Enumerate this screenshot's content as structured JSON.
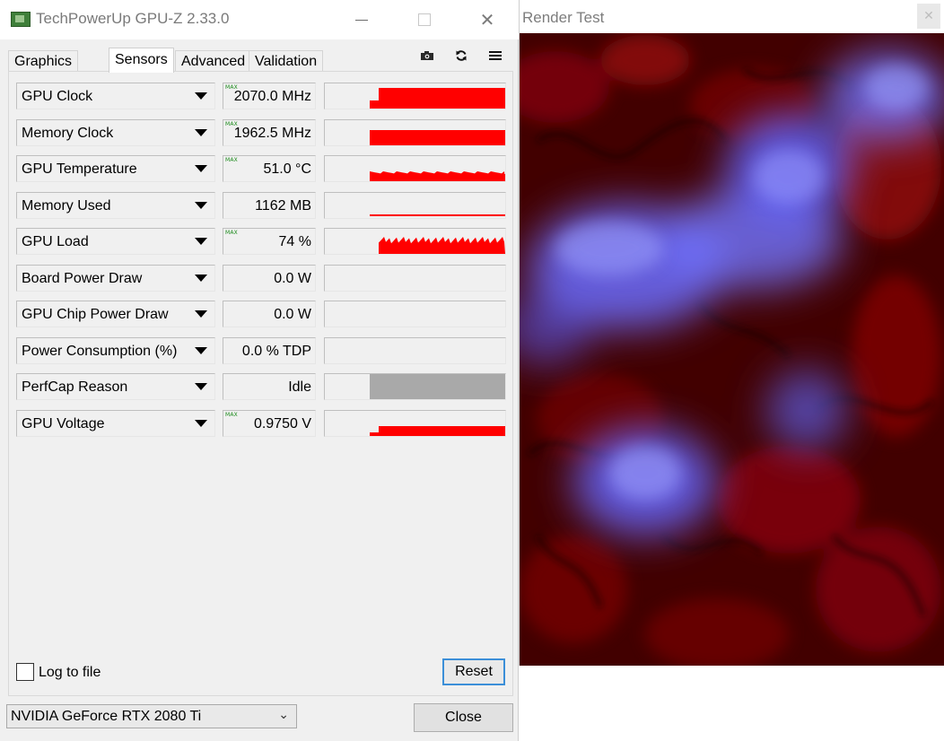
{
  "gpuz": {
    "title": "TechPowerUp GPU-Z 2.33.0",
    "tabs": [
      {
        "label": "Graphics Card",
        "active": false
      },
      {
        "label": "Sensors",
        "active": true
      },
      {
        "label": "Advanced",
        "active": false
      },
      {
        "label": "Validation",
        "active": false
      }
    ],
    "toolbar_icons": [
      "camera-icon",
      "refresh-icon",
      "menu-icon"
    ],
    "max_tag": "MAX",
    "sensors": [
      {
        "label": "GPU Clock",
        "value": "2070.0 MHz",
        "max": true,
        "graph": "step-high"
      },
      {
        "label": "Memory Clock",
        "value": "1962.5 MHz",
        "max": true,
        "graph": "block-high"
      },
      {
        "label": "GPU Temperature",
        "value": "51.0 °C",
        "max": true,
        "graph": "temp"
      },
      {
        "label": "Memory Used",
        "value": "1162 MB",
        "max": false,
        "graph": "line-low"
      },
      {
        "label": "GPU Load",
        "value": "74 %",
        "max": true,
        "graph": "noisy"
      },
      {
        "label": "Board Power Draw",
        "value": "0.0 W",
        "max": false,
        "graph": "none"
      },
      {
        "label": "GPU Chip Power Draw",
        "value": "0.0 W",
        "max": false,
        "graph": "none"
      },
      {
        "label": "Power Consumption (%)",
        "value": "0.0 % TDP",
        "max": false,
        "graph": "none"
      },
      {
        "label": "PerfCap Reason",
        "value": "Idle",
        "max": false,
        "graph": "gray-block"
      },
      {
        "label": "GPU Voltage",
        "value": "0.9750 V",
        "max": true,
        "graph": "step-low"
      }
    ],
    "log_to_file": {
      "label": "Log to file",
      "checked": false
    },
    "reset_label": "Reset",
    "gpu_name": "NVIDIA GeForce RTX 2080 Ti",
    "close_label": "Close",
    "graph_color": "#ff0000",
    "idle_color": "#a9a9a9"
  },
  "render": {
    "title": "Render Test"
  }
}
